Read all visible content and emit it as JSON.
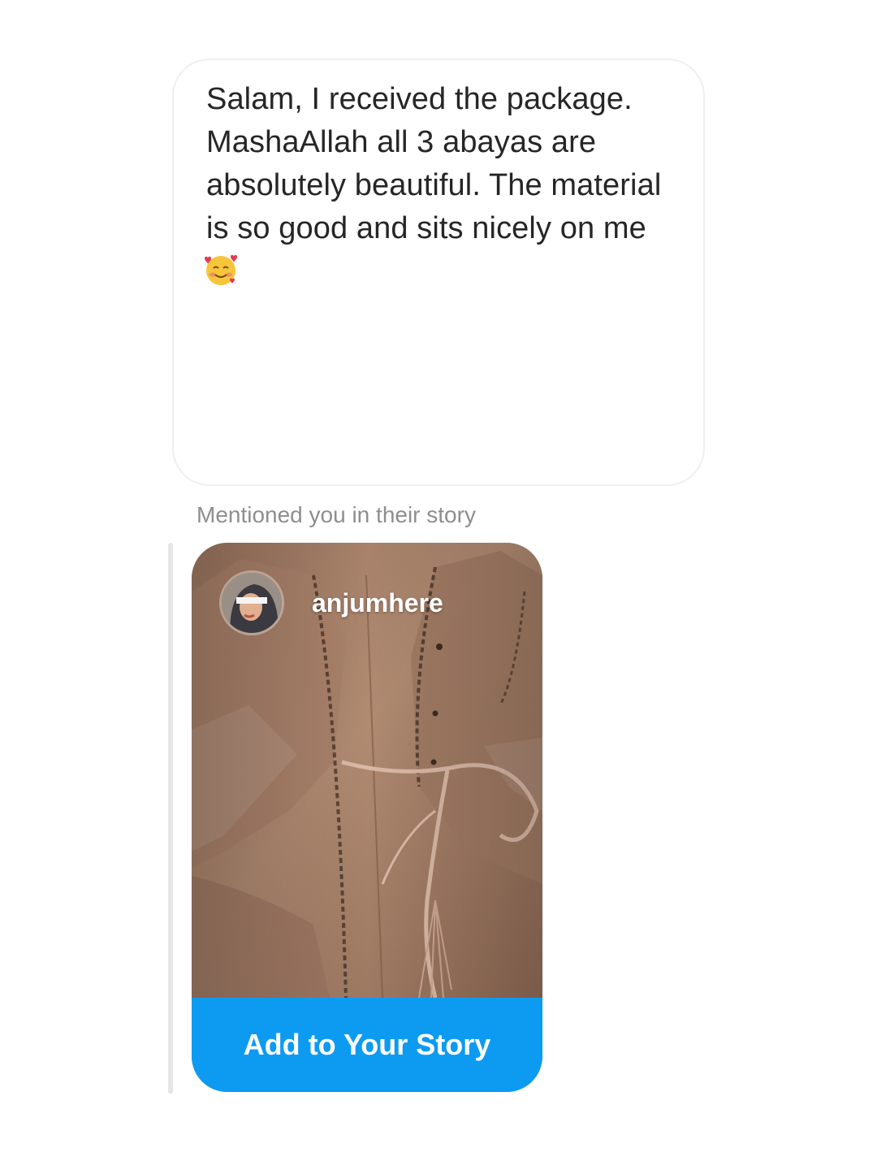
{
  "message": {
    "text": "Salam, I received the package. MashaAllah all 3 abayas are absolutely beautiful. The material is so good and sits nicely on me",
    "emoji": "smiling-face-with-hearts-icon"
  },
  "mention": {
    "caption": "Mentioned you in their story"
  },
  "story": {
    "username": "anjumhere",
    "avatar_icon": "profile-avatar",
    "image_description_icon": "abaya-photo",
    "add_button_label": "Add to Your Story"
  },
  "colors": {
    "button_blue": "#0d9bf2",
    "caption_gray": "#8e8e8e",
    "text_dark": "#262626",
    "bubble_border": "#efefef"
  }
}
